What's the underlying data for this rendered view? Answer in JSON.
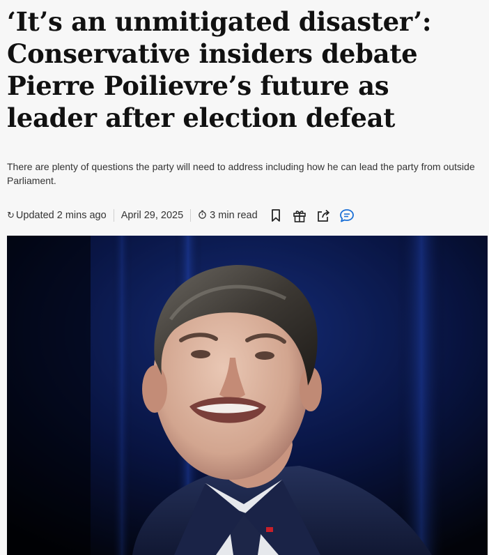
{
  "article": {
    "headline": "‘It’s an unmitigated disaster’: Conservative insiders debate Pierre Poilievre’s future as leader after election defeat",
    "dek": "There are plenty of questions the party will need to address including how he can lead the party from outside Parliament.",
    "updated": "Updated 2 mins ago",
    "date": "April 29, 2025",
    "read_time": "3 min read"
  },
  "icons": {
    "updated": "refresh-clock-icon",
    "read_time": "timer-icon",
    "bookmark": "bookmark-icon",
    "gift": "gift-icon",
    "share": "share-icon",
    "comments": "comment-icon"
  },
  "colors": {
    "accent": "#1a6fd6",
    "background": "#f7f7f7",
    "text": "#111111"
  }
}
